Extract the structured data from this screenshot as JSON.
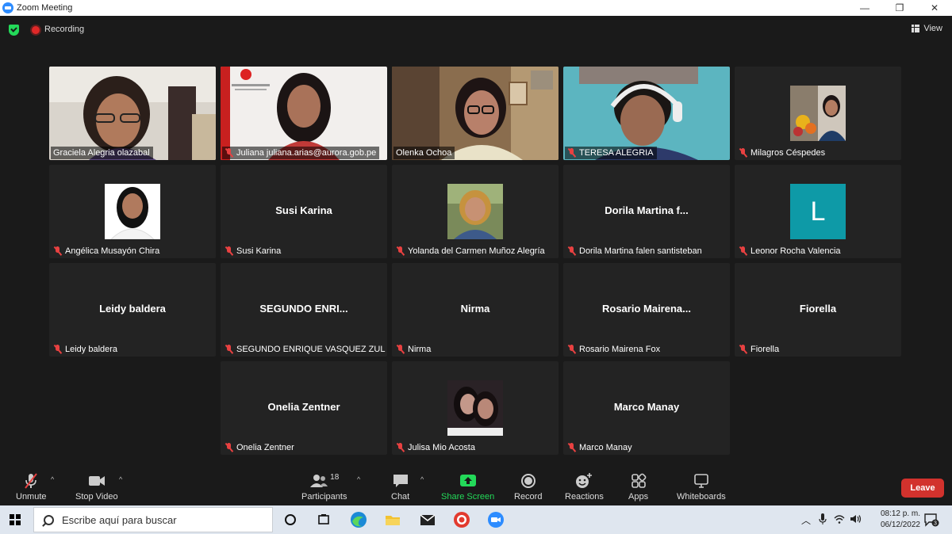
{
  "window": {
    "title": "Zoom Meeting",
    "minimize": "—",
    "maximize": "❐",
    "close": "✕"
  },
  "topbar": {
    "recording": "Recording",
    "view": "View"
  },
  "tiles": [
    {
      "name": "Graciela Alegria olazabal",
      "video": true
    },
    {
      "name": "Juliana juliana.arias@aurora.gob.pe",
      "video": true
    },
    {
      "name": "Olenka Ochoa",
      "video": true,
      "active": true
    },
    {
      "name": "TERESA ALEGRIA",
      "video": true
    },
    {
      "name": "Milagros Céspedes",
      "video": false,
      "avatar": "photo"
    },
    {
      "name": "Angélica Musayón Chira",
      "video": false,
      "avatar": "photo"
    },
    {
      "name": "Susi Karina",
      "big": "Susi Karina"
    },
    {
      "name": "Yolanda del Carmen Muñoz Alegría",
      "video": false,
      "avatar": "photo"
    },
    {
      "name": "Dorila Martina falen santisteban",
      "big": "Dorila  Martina  f..."
    },
    {
      "name": "Leonor Rocha Valencia",
      "avatar": "letter",
      "letter": "L"
    },
    {
      "name": "Leidy baldera",
      "big": "Leidy baldera"
    },
    {
      "name": "SEGUNDO ENRIQUE VASQUEZ ZUL...",
      "big": "SEGUNDO  ENRI..."
    },
    {
      "name": "Nirma",
      "big": "Nirma"
    },
    {
      "name": "Rosario Mairena Fox",
      "big": "Rosario  Mairena..."
    },
    {
      "name": "Fiorella",
      "big": "Fiorella"
    },
    {
      "name": "Onelia Zentner",
      "big": "Onelia Zentner"
    },
    {
      "name": "Julisa Mio Acosta",
      "avatar": "photo"
    },
    {
      "name": "Marco Manay",
      "big": "Marco Manay"
    }
  ],
  "toolbar": {
    "unmute": "Unmute",
    "stop_video": "Stop Video",
    "participants": "Participants",
    "participants_count": "18",
    "chat": "Chat",
    "share_screen": "Share Screen",
    "record": "Record",
    "reactions": "Reactions",
    "apps": "Apps",
    "whiteboards": "Whiteboards",
    "leave": "Leave"
  },
  "taskbar": {
    "search_placeholder": "Escribe aquí para buscar",
    "time": "08:12 p. m.",
    "date": "06/12/2022",
    "notifications": "3"
  },
  "colors": {
    "accent_green": "#23d959",
    "active_speaker": "#c6e63b",
    "leave_red": "#d2322d",
    "share_green": "#23d959"
  }
}
